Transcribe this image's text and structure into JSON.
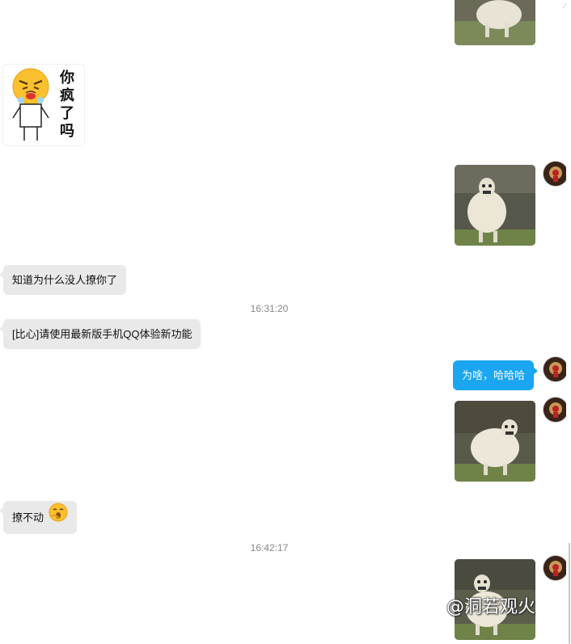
{
  "messages": {
    "text1": "知道为什么没人撩你了",
    "text2": "[比心]请使用最新版手机QQ体验新功能",
    "text3_out": "为啥，哈哈哈",
    "text4": "撩不动"
  },
  "timestamps": {
    "t1": "16:31:20",
    "t2": "16:42:17"
  },
  "sticker": {
    "caption_1": "你",
    "caption_2": "疯",
    "caption_3": "了",
    "caption_4": "吗"
  },
  "watermark": {
    "text": "@洞若观火"
  },
  "colors": {
    "incoming_bubble": "#e9e9e9",
    "outgoing_bubble": "#1aa6f0",
    "timestamp": "#888888"
  },
  "icons": {
    "emoji_in_text4": "yawn-emoji-icon",
    "sticker_face": "angry-face-icon",
    "avatar": "user-avatar-icon"
  }
}
